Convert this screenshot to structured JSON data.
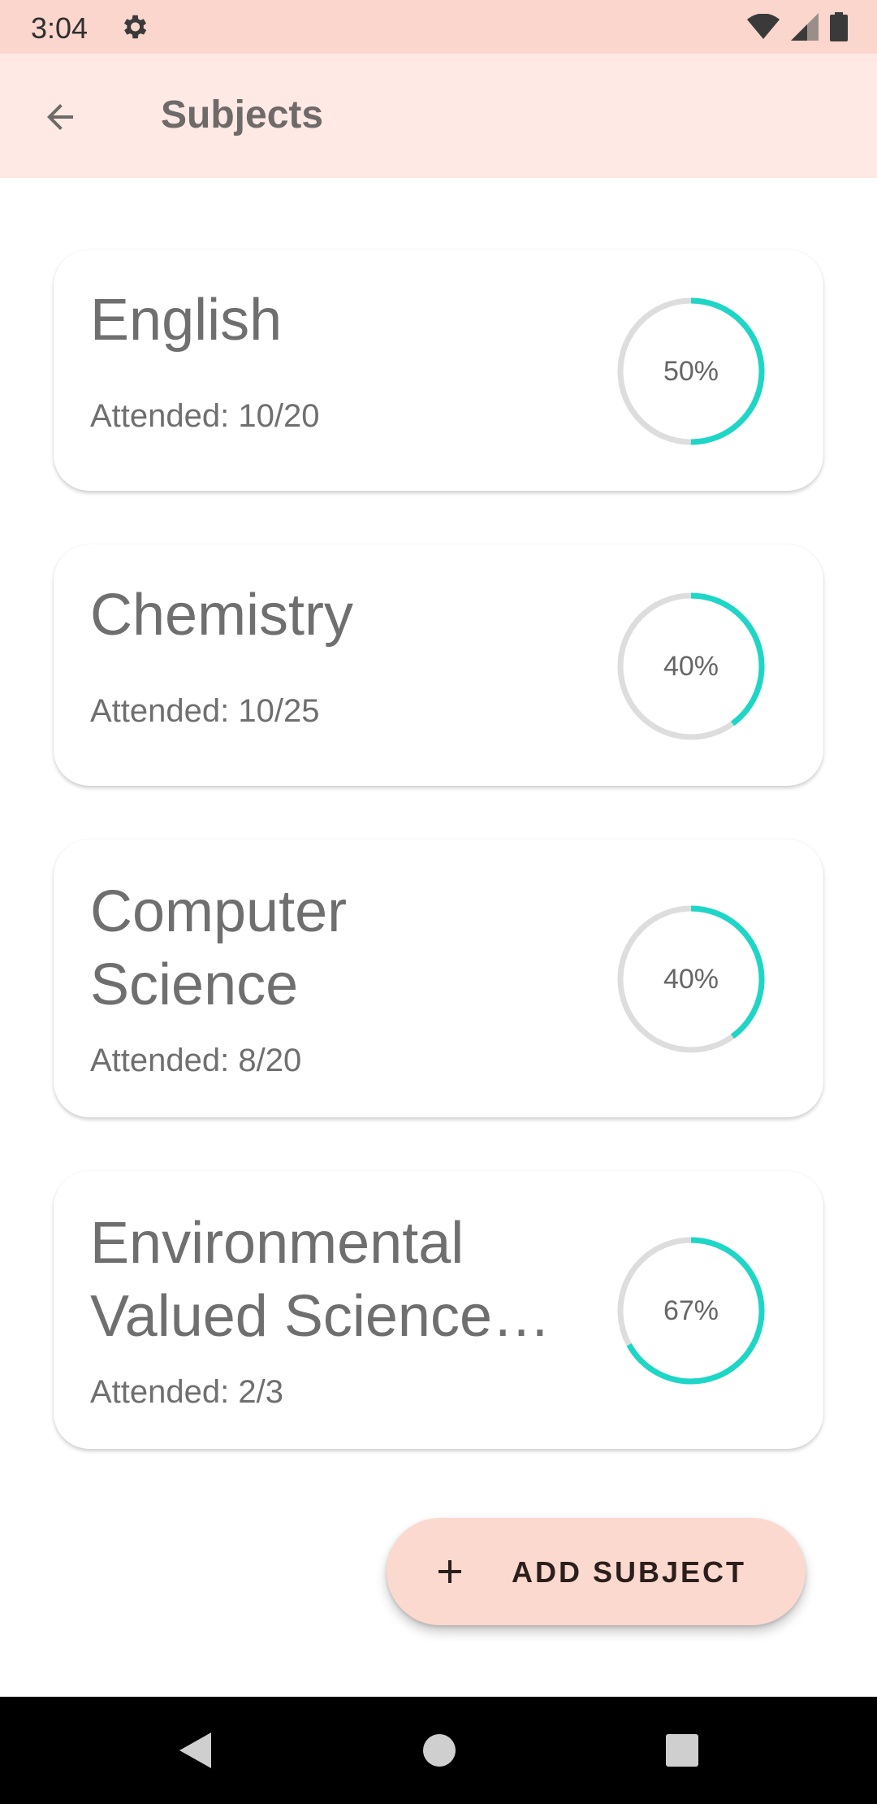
{
  "status_bar": {
    "time": "3:04",
    "icons": [
      "settings-gear-icon",
      "wifi-icon",
      "cell-signal-icon",
      "battery-icon"
    ]
  },
  "app_bar": {
    "title": "Subjects",
    "back_icon": "arrow-left-icon"
  },
  "colors": {
    "status_bar_bg": "#fbd6cc",
    "app_bar_bg": "#ffe9e4",
    "progress_accent": "#1ed6c6",
    "progress_track": "#dddddd",
    "fab_bg": "#fcd9cf"
  },
  "subjects": [
    {
      "name": "English",
      "attended": "Attended: 10/20",
      "percent_label": "50%",
      "fraction": 0.5
    },
    {
      "name": "Chemistry",
      "attended": "Attended: 10/25",
      "percent_label": "40%",
      "fraction": 0.4
    },
    {
      "name": "Computer Science",
      "attended": "Attended: 8/20",
      "percent_label": "40%",
      "fraction": 0.4
    },
    {
      "name": "Environmental Valued Science…",
      "attended": "Attended: 2/3",
      "percent_label": "67%",
      "fraction": 0.67
    }
  ],
  "fab": {
    "label": "ADD SUBJECT",
    "icon": "plus-icon"
  },
  "nav_bar": {
    "buttons": [
      "back-triangle-icon",
      "home-circle-icon",
      "recents-square-icon"
    ]
  }
}
